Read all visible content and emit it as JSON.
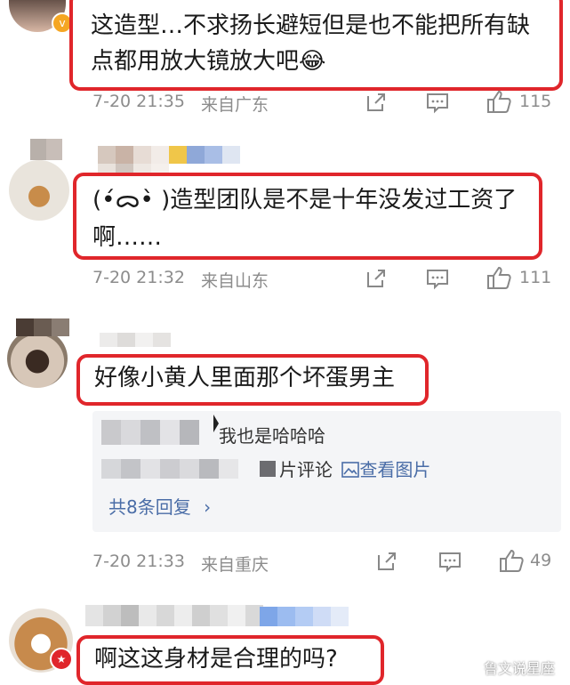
{
  "comments": [
    {
      "text_line1": "这造型…不求扬长避短但是也不能把所有缺",
      "text_line2": "点都用放大镜放大吧😂",
      "time": "7-20 21:35",
      "location": "来自广东",
      "likes": "115"
    },
    {
      "text_line1": "(•́ᯅ•̀ )造型团队是不是十年没发过工资了",
      "text_line2": "啊……",
      "time": "7-20 21:32",
      "location": "来自山东",
      "likes": "111"
    },
    {
      "text_line1": "好像小黄人里面那个坏蛋男主",
      "time": "7-20 21:33",
      "location": "来自重庆",
      "likes": "49",
      "replies": {
        "reply1_text": "我也是哈哈哈",
        "reply2_text": "片评论",
        "reply2_link": "查看图片",
        "more_label": "共8条回复",
        "more_arrow": "›"
      }
    },
    {
      "text_line1": "啊这这身材是合理的吗?"
    }
  ],
  "watermark": "鲁文说星座",
  "colors": {
    "highlight": "#e0262b",
    "link": "#4a6da7",
    "meta": "#8c8c8c"
  },
  "icons": [
    "share-icon",
    "comment-icon",
    "thumbs-up-icon",
    "verified-badge-icon",
    "image-icon",
    "chevron-right-icon"
  ]
}
